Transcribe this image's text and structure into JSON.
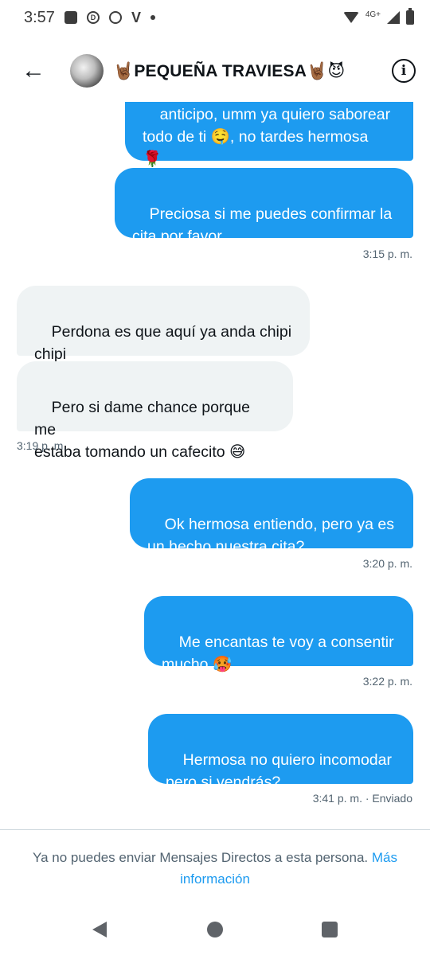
{
  "status_bar": {
    "time": "3:57",
    "network": "4G+"
  },
  "header": {
    "name": "🤘🏾PEQUEÑA TRAVIESA🤘🏾😈",
    "back_icon": "arrow-left-icon",
    "info_icon": "info-icon"
  },
  "messages": [
    {
      "type": "sent",
      "text": "anticipo, umm ya quiero saborear\ntodo de ti 🤤, no tardes hermosa\n🌹"
    },
    {
      "type": "sent",
      "text": "Preciosa si me puedes confirmar la\ncita por favor"
    },
    {
      "type": "timestamp",
      "text": "3:15 p. m."
    },
    {
      "type": "received",
      "text": "Perdona es que aquí ya anda chipi\nchipi"
    },
    {
      "type": "received",
      "text": "Pero si dame chance porque me\nestaba tomando un cafecito 😅"
    },
    {
      "type": "timestamp",
      "text": "3:19 p. m."
    },
    {
      "type": "sent",
      "text": "Ok hermosa entiendo, pero ya es\nun hecho nuestra cita?"
    },
    {
      "type": "timestamp",
      "text": "3:20 p. m."
    },
    {
      "type": "sent",
      "text": "Me encantas te voy a consentir\nmucho 🥵"
    },
    {
      "type": "timestamp",
      "text": "3:22 p. m."
    },
    {
      "type": "sent",
      "text": "Hermosa no quiero incomodar\npero si vendrás?"
    },
    {
      "type": "timestamp",
      "text": "3:41 p. m. · Enviado"
    }
  ],
  "footer": {
    "notice_text": "Ya no puedes enviar Mensajes Directos a esta persona. ",
    "notice_link": "Más información"
  },
  "colors": {
    "sent_bubble": "#1d9bf0",
    "received_bubble": "#eff3f4",
    "link": "#1d9bf0"
  }
}
